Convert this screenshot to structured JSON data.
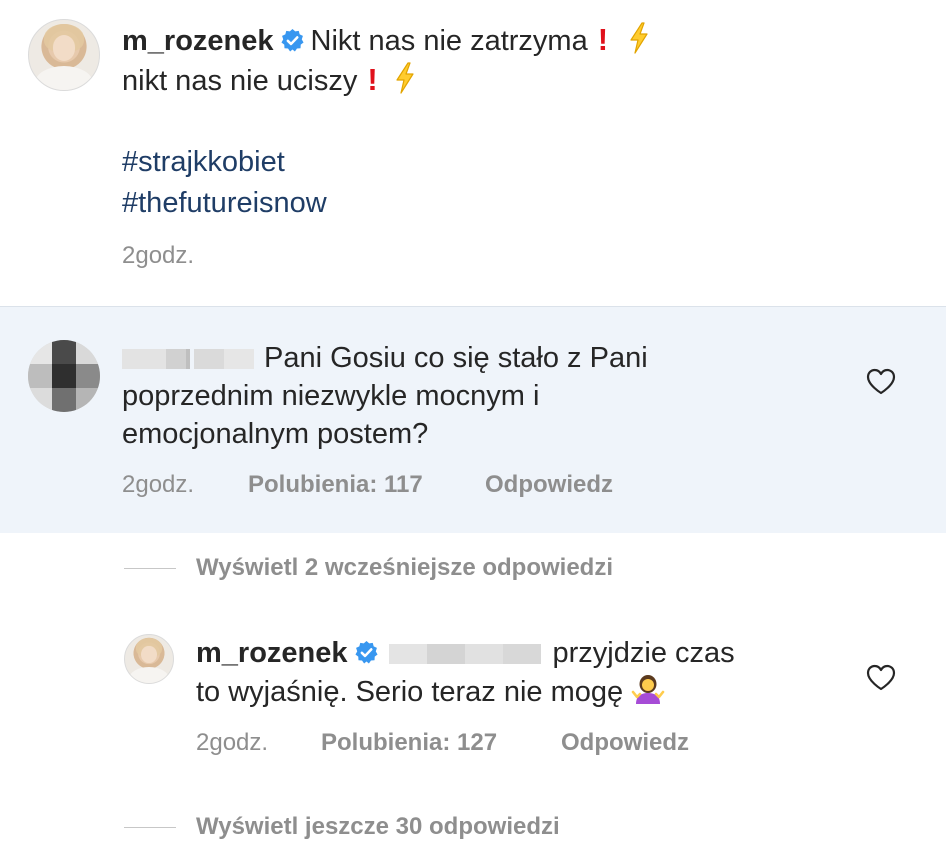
{
  "caption": {
    "username": "m_rozenek",
    "line1_text": "Nikt nas nie zatrzyma",
    "line2_text": "nikt nas nie uciszy",
    "hashtags": [
      "#strajkkobiet",
      "#thefutureisnow"
    ],
    "time": "2godz."
  },
  "comment": {
    "text_line1": "Pani Gosiu co się stało z Pani",
    "text_line2": "poprzednim niezwykle mocnym i",
    "text_line3": "emocjonalnym postem?",
    "time": "2godz.",
    "likes": "Polubienia: 117",
    "reply": "Odpowiedz"
  },
  "earlier_replies": {
    "label": "Wyświetl 2 wcześniejsze odpowiedzi"
  },
  "reply_comment": {
    "username": "m_rozenek",
    "text_line1": "przyjdzie czas",
    "text_line2": "to wyjaśnię. Serio teraz nie mogę",
    "time": "2godz.",
    "likes": "Polubienia: 127",
    "reply": "Odpowiedz"
  },
  "more_replies": {
    "label": "Wyświetl jeszcze 30 odpowiedzi"
  },
  "icons": {
    "verified": "verified-badge-icon",
    "heart": "heart-outline-icon",
    "exclamation": "red-exclamation-emoji-icon",
    "lightning": "lightning-emoji-icon",
    "shrug": "woman-shrugging-emoji-icon"
  },
  "colors": {
    "text": "#262626",
    "secondary": "#8e8e8e",
    "hashtag": "#1f3d66",
    "verified": "#3897f0",
    "highlight_bg": "#eff4fa"
  }
}
